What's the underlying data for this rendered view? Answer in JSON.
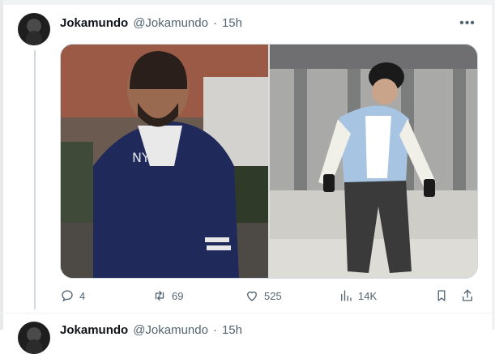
{
  "tweet": {
    "author": {
      "name": "Jokamundo",
      "handle": "@Jokamundo",
      "separator": "·",
      "time": "15h"
    },
    "media": [
      {
        "alt_icon": "photo-left"
      },
      {
        "alt_icon": "photo-right"
      }
    ],
    "actions": {
      "replies": "4",
      "retweets": "69",
      "likes": "525",
      "views": "14K"
    }
  },
  "next_tweet": {
    "author": {
      "name": "Jokamundo",
      "handle": "@Jokamundo",
      "separator": "·",
      "time": "15h"
    }
  },
  "colors": {
    "text_primary": "#0f1419",
    "text_secondary": "#536471",
    "border": "#cfd9de"
  }
}
